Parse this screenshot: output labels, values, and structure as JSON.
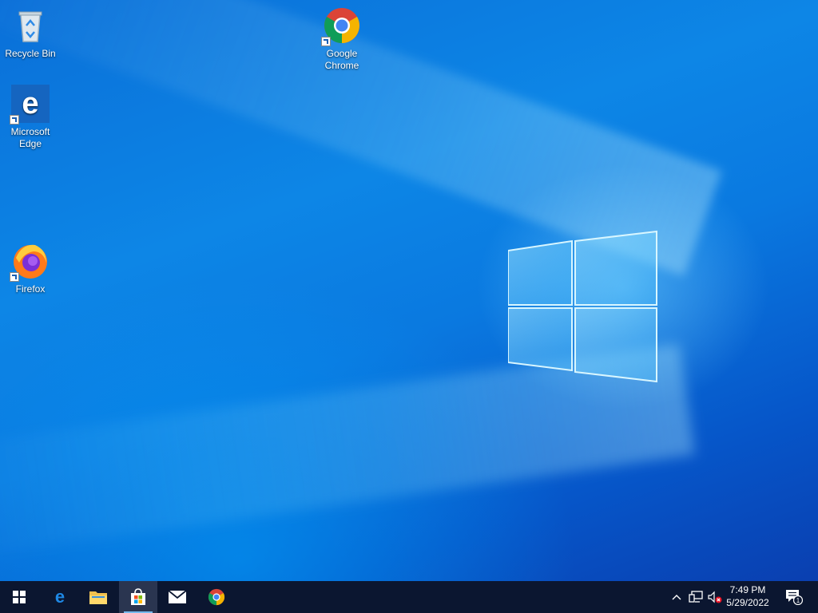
{
  "desktop": {
    "icons": {
      "recycle_bin": {
        "label": "Recycle Bin",
        "icon": "recycle-bin-icon"
      },
      "edge": {
        "label": "Microsoft Edge",
        "icon": "edge-icon",
        "shortcut": true
      },
      "firefox": {
        "label": "Firefox",
        "icon": "firefox-icon",
        "shortcut": true
      },
      "chrome": {
        "label": "Google Chrome",
        "icon": "chrome-icon",
        "shortcut": true
      }
    },
    "wallpaper": {
      "primary_color": "#0a79e0",
      "logo": "windows-logo"
    }
  },
  "taskbar": {
    "background": "#0b1630",
    "start": {
      "icon": "windows-start-icon"
    },
    "pinned": [
      {
        "name": "edge",
        "icon": "edge-icon"
      },
      {
        "name": "file-explorer",
        "icon": "folder-icon"
      },
      {
        "name": "microsoft-store",
        "icon": "store-icon",
        "active": true
      },
      {
        "name": "mail",
        "icon": "mail-icon"
      },
      {
        "name": "chrome",
        "icon": "chrome-icon"
      }
    ],
    "tray": {
      "icons": [
        "chevron-up-icon",
        "network-icon",
        "volume-muted-icon"
      ],
      "time": "7:49 PM",
      "date": "5/29/2022",
      "notifications": {
        "icon": "action-center-icon",
        "count": "1"
      }
    }
  }
}
